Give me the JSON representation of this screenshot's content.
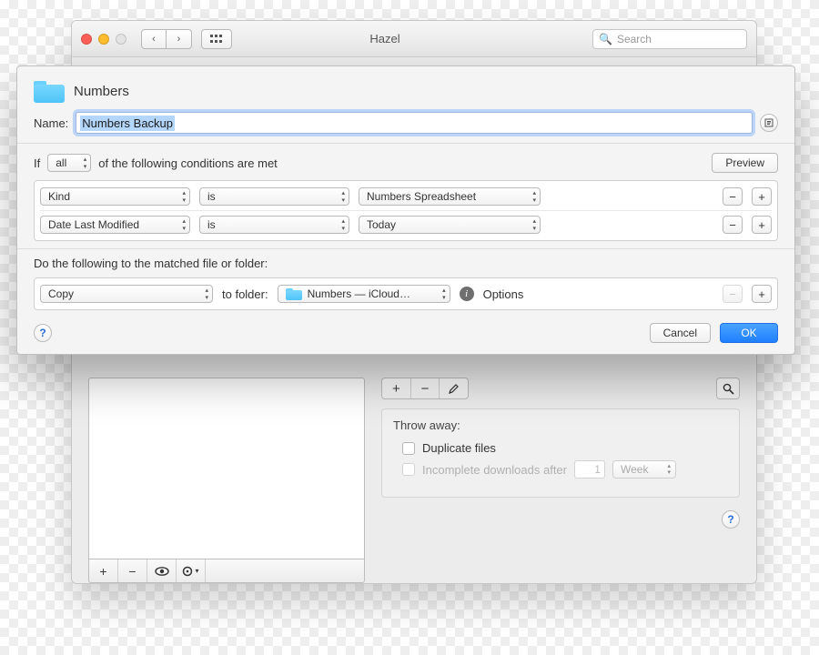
{
  "window": {
    "title": "Hazel",
    "search_placeholder": "Search"
  },
  "sheet": {
    "folder_title": "Numbers",
    "name_label": "Name:",
    "name_value": "Numbers Backup",
    "conditions": {
      "prefix": "If",
      "scope": "all",
      "suffix": "of the following conditions are met",
      "preview": "Preview",
      "rows": [
        {
          "attr": "Kind",
          "op": "is",
          "val": "Numbers Spreadsheet"
        },
        {
          "attr": "Date Last Modified",
          "op": "is",
          "val": "Today"
        }
      ]
    },
    "actions": {
      "heading": "Do the following to the matched file or folder:",
      "verb": "Copy",
      "to_label": "to folder:",
      "target": "Numbers — iCloud…",
      "options": "Options"
    },
    "buttons": {
      "cancel": "Cancel",
      "ok": "OK"
    }
  },
  "back": {
    "throwaway": {
      "heading": "Throw away:",
      "dup": "Duplicate files",
      "incomplete": "Incomplete downloads after",
      "incomplete_n": "1",
      "incomplete_unit": "Week"
    }
  }
}
